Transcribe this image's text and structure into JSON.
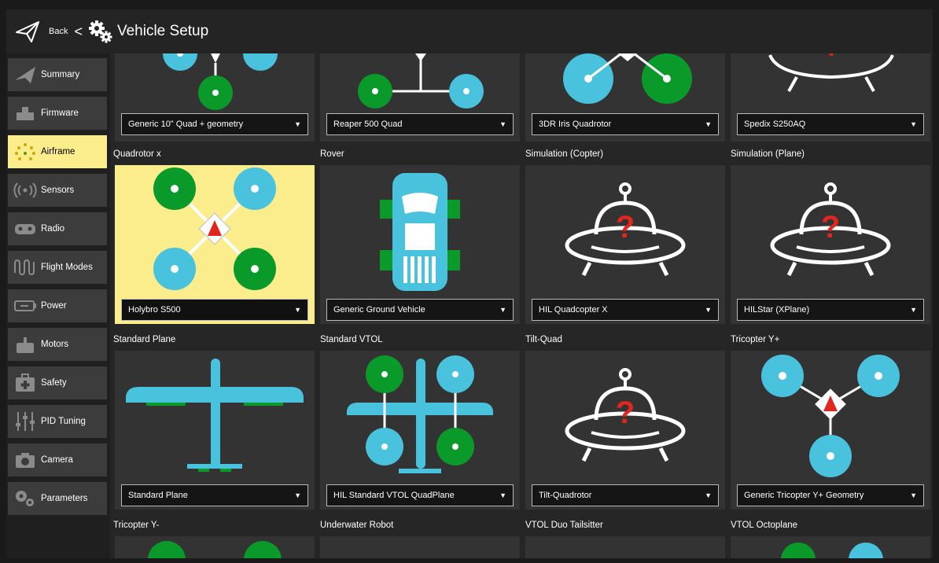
{
  "header": {
    "back_label": "Back",
    "back_arrow": "<",
    "title": "Vehicle Setup",
    "icons": [
      "paper-plane-icon",
      "gears-icon"
    ]
  },
  "sidebar": {
    "items": [
      {
        "label": "Summary",
        "icon": "plane-icon",
        "active": false
      },
      {
        "label": "Firmware",
        "icon": "chip-icon",
        "active": false
      },
      {
        "label": "Airframe",
        "icon": "airframe-dots-icon",
        "active": true
      },
      {
        "label": "Sensors",
        "icon": "radio-waves-icon",
        "active": false
      },
      {
        "label": "Radio",
        "icon": "gamepad-icon",
        "active": false
      },
      {
        "label": "Flight Modes",
        "icon": "flight-modes-icon",
        "active": false
      },
      {
        "label": "Power",
        "icon": "battery-icon",
        "active": false
      },
      {
        "label": "Motors",
        "icon": "motor-icon",
        "active": false
      },
      {
        "label": "Safety",
        "icon": "medkit-icon",
        "active": false
      },
      {
        "label": "PID Tuning",
        "icon": "sliders-icon",
        "active": false
      },
      {
        "label": "Camera",
        "icon": "camera-icon",
        "active": false
      },
      {
        "label": "Parameters",
        "icon": "gears-icon",
        "active": false
      }
    ]
  },
  "rows": [
    {
      "cards": [
        {
          "selection": "Generic 10\" Quad + geometry",
          "art": "quad-plus-icon"
        },
        {
          "selection": "Reaper 500 Quad",
          "art": "quad-h-icon"
        },
        {
          "selection": "3DR Iris Quadrotor",
          "art": "quad-wide-icon"
        },
        {
          "selection": "Spedix S250AQ",
          "art": "ufo-icon"
        }
      ]
    },
    {
      "headings": [
        "Quadrotor x",
        "Rover",
        "Simulation (Copter)",
        "Simulation (Plane)"
      ],
      "cards": [
        {
          "selection": "Holybro S500",
          "art": "quadrotor-x-icon",
          "selected": true
        },
        {
          "selection": "Generic Ground Vehicle",
          "art": "rover-icon"
        },
        {
          "selection": "HIL Quadcopter X",
          "art": "ufo-question-icon"
        },
        {
          "selection": "HILStar (XPlane)",
          "art": "ufo-question-icon"
        }
      ]
    },
    {
      "headings": [
        "Standard Plane",
        "Standard VTOL",
        "Tilt-Quad",
        "Tricopter Y+"
      ],
      "cards": [
        {
          "selection": "Standard Plane",
          "art": "standard-plane-icon"
        },
        {
          "selection": "HIL Standard VTOL QuadPlane",
          "art": "vtol-icon"
        },
        {
          "selection": "Tilt-Quadrotor",
          "art": "ufo-question-icon"
        },
        {
          "selection": "Generic Tricopter Y+ Geometry",
          "art": "tricopter-icon"
        }
      ]
    },
    {
      "headings": [
        "Tricopter Y-",
        "Underwater Robot",
        "VTOL Duo Tailsitter",
        "VTOL Octoplane"
      ],
      "cards": []
    }
  ],
  "colors": {
    "accent": "#fbec8c",
    "green": "#0a9a2a",
    "blue": "#49c2dd",
    "red": "#e0261f"
  }
}
